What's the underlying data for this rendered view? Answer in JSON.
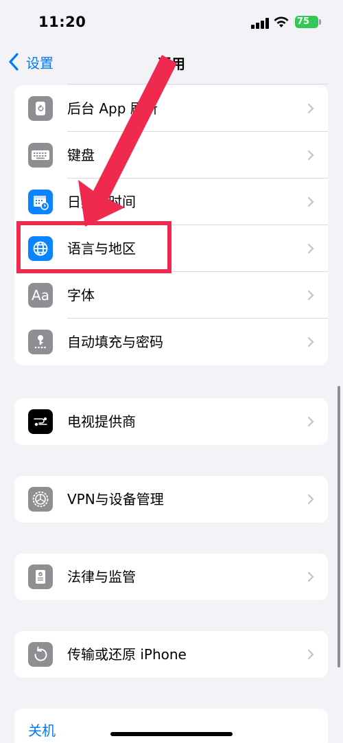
{
  "status_bar": {
    "time": "11:20",
    "battery": "75"
  },
  "nav": {
    "back_label": "设置",
    "title": "通用"
  },
  "groups": {
    "main": [
      {
        "label": "后台 App 刷新",
        "icon": "background-refresh-icon"
      },
      {
        "label": "键盘",
        "icon": "keyboard-icon"
      },
      {
        "label": "日期与时间",
        "icon": "calendar-clock-icon"
      },
      {
        "label": "语言与地区",
        "icon": "globe-icon"
      },
      {
        "label": "字体",
        "icon": "font-icon",
        "icon_text": "Aa"
      },
      {
        "label": "自动填充与密码",
        "icon": "key-icon"
      }
    ],
    "tv": [
      {
        "label": "电视提供商",
        "icon": "tv-provider-icon"
      }
    ],
    "vpn": [
      {
        "label": "VPN与设备管理",
        "icon": "gear-icon"
      }
    ],
    "legal": [
      {
        "label": "法律与监管",
        "icon": "document-badge-icon"
      }
    ],
    "reset": [
      {
        "label": "传输或还原 iPhone",
        "icon": "reset-icon"
      }
    ]
  },
  "shutdown_label": "关机",
  "colors": {
    "accent": "#007aff",
    "highlight": "#f0294f",
    "battery": "#34c759"
  }
}
